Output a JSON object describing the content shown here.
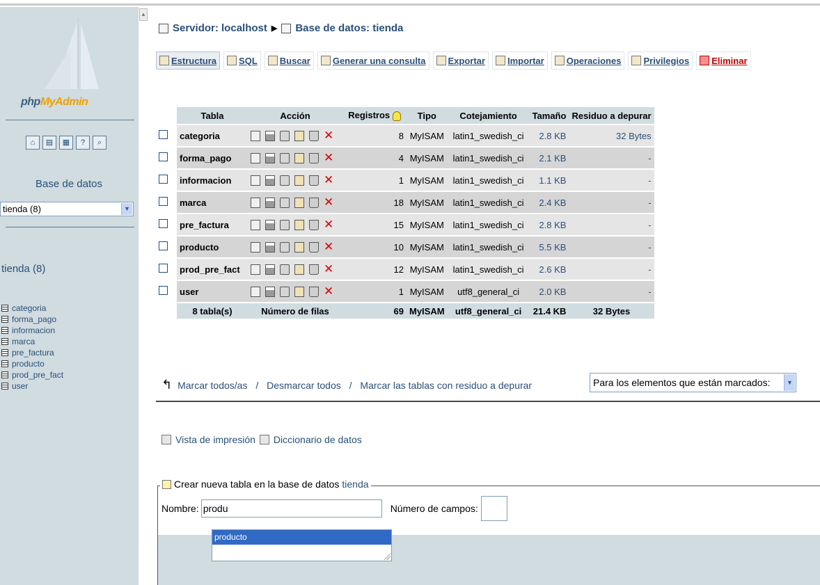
{
  "breadcrumb": {
    "server": "Servidor: localhost",
    "database": "Base de datos: tienda"
  },
  "tabs": [
    {
      "label": "Estructura"
    },
    {
      "label": "SQL"
    },
    {
      "label": "Buscar"
    },
    {
      "label": "Generar una consulta"
    },
    {
      "label": "Exportar"
    },
    {
      "label": "Importar"
    },
    {
      "label": "Operaciones"
    },
    {
      "label": "Privilegios"
    },
    {
      "label": "Eliminar"
    }
  ],
  "sidebar": {
    "logo_part1": "php",
    "logo_part2": "MyAdmin",
    "db_label": "Base de datos",
    "db_select": "tienda (8)",
    "db_name": "tienda (8)",
    "tables": [
      "categoria",
      "forma_pago",
      "informacion",
      "marca",
      "pre_factura",
      "producto",
      "prod_pre_fact",
      "user"
    ]
  },
  "table": {
    "headers": {
      "tabla": "Tabla",
      "accion": "Acción",
      "registros": "Registros",
      "tipo": "Tipo",
      "cotejamiento": "Cotejamiento",
      "tamano": "Tamaño",
      "residuo": "Residuo a depurar"
    },
    "rows": [
      {
        "name": "categoria",
        "records": "8",
        "type": "MyISAM",
        "collation": "latin1_swedish_ci",
        "size": "2.8 KB",
        "overhead": "32 Bytes"
      },
      {
        "name": "forma_pago",
        "records": "4",
        "type": "MyISAM",
        "collation": "latin1_swedish_ci",
        "size": "2.1 KB",
        "overhead": "-"
      },
      {
        "name": "informacion",
        "records": "1",
        "type": "MyISAM",
        "collation": "latin1_swedish_ci",
        "size": "1.1 KB",
        "overhead": "-"
      },
      {
        "name": "marca",
        "records": "18",
        "type": "MyISAM",
        "collation": "latin1_swedish_ci",
        "size": "2.4 KB",
        "overhead": "-"
      },
      {
        "name": "pre_factura",
        "records": "15",
        "type": "MyISAM",
        "collation": "latin1_swedish_ci",
        "size": "2.8 KB",
        "overhead": "-"
      },
      {
        "name": "producto",
        "records": "10",
        "type": "MyISAM",
        "collation": "latin1_swedish_ci",
        "size": "5.5 KB",
        "overhead": "-"
      },
      {
        "name": "prod_pre_fact",
        "records": "12",
        "type": "MyISAM",
        "collation": "latin1_swedish_ci",
        "size": "2.6 KB",
        "overhead": "-"
      },
      {
        "name": "user",
        "records": "1",
        "type": "MyISAM",
        "collation": "utf8_general_ci",
        "size": "2.0 KB",
        "overhead": "-"
      }
    ],
    "footer": {
      "count": "8 tabla(s)",
      "label": "Número de filas",
      "records": "69",
      "type": "MyISAM",
      "collation": "utf8_general_ci",
      "size": "21.4 KB",
      "overhead": "32 Bytes"
    }
  },
  "mark": {
    "all": "Marcar todos/as",
    "sep1": " / ",
    "none": "Desmarcar todos",
    "sep2": " / ",
    "overhead": "Marcar las tablas con residuo a depurar",
    "with_selected": "Para los elementos que están marcados:"
  },
  "links": {
    "print": "Vista de impresión",
    "dictionary": "Diccionario de datos"
  },
  "create": {
    "legend": "Crear nueva tabla en la base de datos",
    "db": "tienda",
    "name_label": "Nombre:",
    "name_value": "produ",
    "fields_label": "Número de campos:",
    "suggestion": "producto"
  },
  "colors": {
    "link": "#2b4f78",
    "header_bg": "#d0dce0",
    "delete": "#d90000",
    "highlight": "#316ac5"
  }
}
